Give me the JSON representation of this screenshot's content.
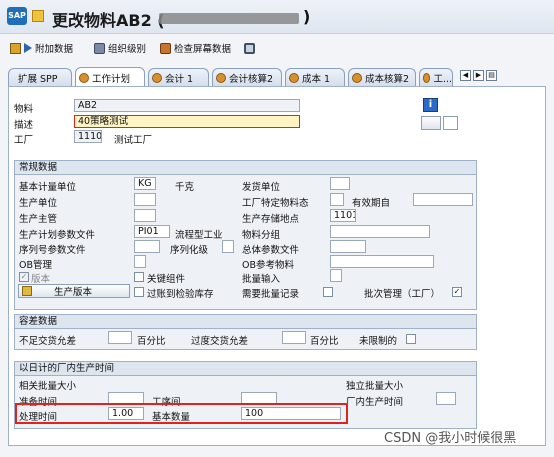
{
  "title": {
    "text": "更改物料AB2 (",
    "end": ")",
    "icon": "SAP"
  },
  "toolbar": [
    {
      "label": "附加数据",
      "icon": "additional-data-icon"
    },
    {
      "label": "组织级别",
      "icon": "org-levels-icon"
    },
    {
      "label": "检查屏幕数据",
      "icon": "check-screen-icon"
    },
    {
      "label": "",
      "icon": "lock-icon"
    }
  ],
  "tabs": [
    {
      "label": "扩展 SPP"
    },
    {
      "label": "工作计划"
    },
    {
      "label": "会计 1"
    },
    {
      "label": "会计核算2"
    },
    {
      "label": "成本 1"
    },
    {
      "label": "成本核算2"
    },
    {
      "label": "工..."
    }
  ],
  "header": {
    "material_label": "物料",
    "material_value": "AB2",
    "desc_label": "描述",
    "desc_value": "40策略测试",
    "plant_label": "工厂",
    "plant_value": "1110",
    "plant_name": "测试工厂"
  },
  "general": {
    "title": "常规数据",
    "base_uom_label": "基本计量单位",
    "base_uom_value": "KG",
    "base_uom_text": "千克",
    "issue_unit_label": "发货单位",
    "prod_unit_label": "生产单位",
    "plant_status_label": "工厂特定物料态",
    "valid_from_label": "有效期自",
    "supervisor_label": "生产主管",
    "storage_loc_label": "生产存储地点",
    "storage_loc_value": "1101",
    "sched_profile_label": "生产计划参数文件",
    "sched_profile_value": "PI01",
    "sched_profile_text": "流程型工业",
    "material_group_label": "物料分组",
    "serial_profile_label": "序列号参数文件",
    "serialization_label": "序列化级",
    "overall_profile_label": "总体参数文件",
    "ob_mgmt_label": "OB管理",
    "ob_ref_label": "OB参考物料",
    "version_label": "版本",
    "version_checked": "✓",
    "key_component_label": "关键组件",
    "batch_entry_label": "批量输入",
    "prod_version_button": "生产版本",
    "posting_label": "过账到检验库存",
    "batch_record_label": "需要批量记录",
    "batch_mgmt_label": "批次管理（工厂）",
    "batch_mgmt_checked": "✓"
  },
  "tolerance": {
    "title": "容差数据",
    "under_label": "不足交货允差",
    "under_unit": "百分比",
    "over_label": "过度交货允差",
    "over_unit": "百分比",
    "unlimited_label": "未限制的"
  },
  "inhouse": {
    "title": "以日计的厂内生产时间",
    "lot_dep_label": "相关批量大小",
    "lot_indep_label": "独立批量大小",
    "setup_label": "准备时间",
    "interop_label": "工序间",
    "inhouse_label": "厂内生产时间",
    "processing_label": "处理时间",
    "processing_value": "1.00",
    "base_qty_label": "基本数量",
    "base_qty_value": "100"
  },
  "watermark": "CSDN @我小时候很黑"
}
